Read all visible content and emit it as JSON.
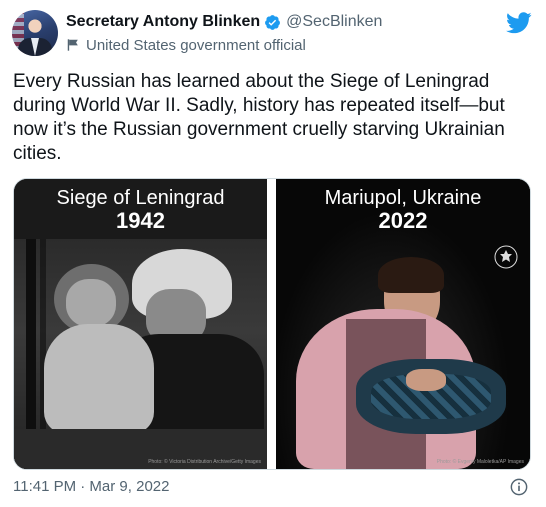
{
  "author": {
    "display_name": "Secretary Antony Blinken",
    "handle": "@SecBlinken",
    "label": "United States government official",
    "avatar_icon": "profile-photo",
    "verified_icon": "verified-badge-icon"
  },
  "tweet": {
    "text": "Every Russian has learned about the Siege of Leningrad during World War II. Sadly, history has repeated itself—but now it’s the Russian government cruelly starving Ukrainian cities."
  },
  "media": {
    "left": {
      "title": "Siege of Leningrad",
      "year": "1942",
      "credit": "Photo: © Victoria Distribution Archive/Getty Images"
    },
    "right": {
      "title": "Mariupol, Ukraine",
      "year": "2022",
      "credit": "Photo: © Evgeniy Maloletka/AP Images",
      "seal_icon": "state-department-seal-icon"
    }
  },
  "footer": {
    "timestamp": "11:41 PM · Mar 9, 2022",
    "info_icon": "info-icon"
  },
  "colors": {
    "twitter_blue": "#1d9bf0",
    "text_primary": "#0f1419",
    "text_secondary": "#536471"
  }
}
